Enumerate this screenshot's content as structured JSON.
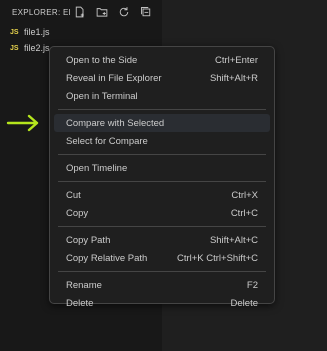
{
  "explorer": {
    "title": "EXPLORER: ED...",
    "header_icons": [
      "new-file-icon",
      "new-folder-icon",
      "refresh-icon",
      "collapse-all-icon"
    ],
    "files": [
      {
        "icon": "JS",
        "name": "file1.js"
      },
      {
        "icon": "JS",
        "name": "file2.js"
      }
    ]
  },
  "context_menu": {
    "groups": [
      [
        {
          "label": "Open to the Side",
          "shortcut": "Ctrl+Enter"
        },
        {
          "label": "Reveal in File Explorer",
          "shortcut": "Shift+Alt+R"
        },
        {
          "label": "Open in Terminal",
          "shortcut": ""
        }
      ],
      [
        {
          "label": "Compare with Selected",
          "shortcut": ""
        },
        {
          "label": "Select for Compare",
          "shortcut": ""
        }
      ],
      [
        {
          "label": "Open Timeline",
          "shortcut": ""
        }
      ],
      [
        {
          "label": "Cut",
          "shortcut": "Ctrl+X"
        },
        {
          "label": "Copy",
          "shortcut": "Ctrl+C"
        }
      ],
      [
        {
          "label": "Copy Path",
          "shortcut": "Shift+Alt+C"
        },
        {
          "label": "Copy Relative Path",
          "shortcut": "Ctrl+K Ctrl+Shift+C"
        }
      ],
      [
        {
          "label": "Rename",
          "shortcut": "F2"
        },
        {
          "label": "Delete",
          "shortcut": "Delete"
        }
      ]
    ]
  },
  "annotation": {
    "arrow_color": "#b5e61d"
  },
  "colors": {
    "js_icon": "#e8d44d",
    "menu_bg": "#1f1f1f",
    "hover_bg": "#2a2d32"
  }
}
